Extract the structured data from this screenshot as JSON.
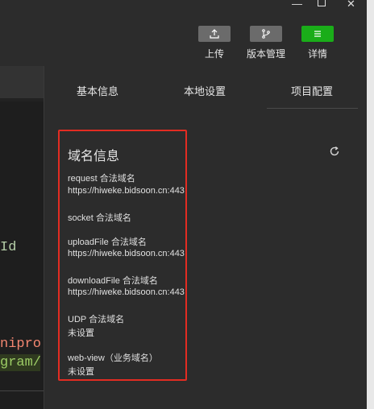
{
  "window": {
    "minimize_icon": "minimize-icon",
    "maximize_icon": "maximize-icon",
    "close_icon": "close-icon"
  },
  "toolbar": {
    "upload_label": "上传",
    "version_label": "版本管理",
    "details_label": "详情",
    "details_color": "#1aad19"
  },
  "editor": {
    "line_a": "Id",
    "line_b": "nipro",
    "line_c": "gram/"
  },
  "tabs": [
    {
      "label": "基本信息"
    },
    {
      "label": "本地设置"
    },
    {
      "label": "项目配置"
    }
  ],
  "domain_info": {
    "title": "域名信息",
    "items": [
      {
        "label": "request 合法域名",
        "value": "https://hiweke.bidsoon.cn:443"
      },
      {
        "label": "socket 合法域名",
        "value": ""
      },
      {
        "label": "uploadFile 合法域名",
        "value": "https://hiweke.bidsoon.cn:443"
      },
      {
        "label": "downloadFile 合法域名",
        "value": "https://hiweke.bidsoon.cn:443"
      },
      {
        "label": "UDP 合法域名",
        "value": "未设置"
      },
      {
        "label": "web-view（业务域名）",
        "value": "未设置"
      }
    ]
  },
  "colors": {
    "highlight_border": "#e32c22"
  }
}
